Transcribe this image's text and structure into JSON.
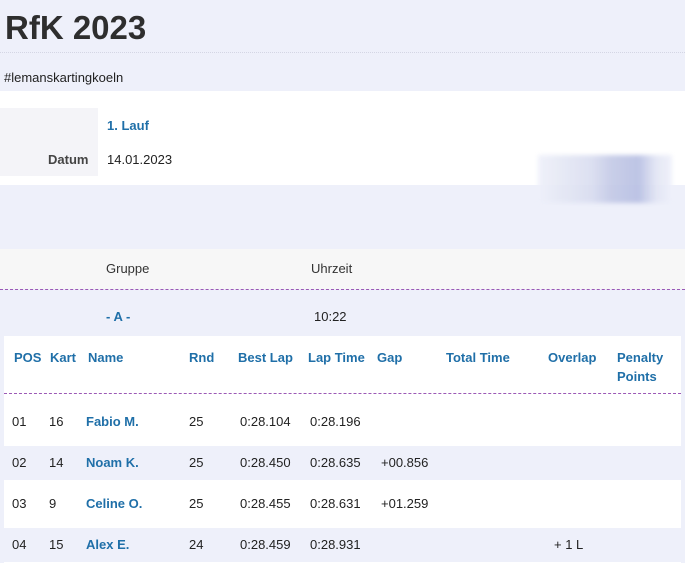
{
  "page": {
    "title": "RfK 2023",
    "hashtag": "#lemanskartingkoeln"
  },
  "event": {
    "race_title": "1. Lauf",
    "date_label": "Datum",
    "date_value": "14.01.2023"
  },
  "groups": {
    "header_group": "Gruppe",
    "header_time": "Uhrzeit",
    "group_name": "- A -",
    "group_time": "10:22"
  },
  "results": {
    "columns": {
      "pos": "POS",
      "kart": "Kart",
      "name": "Name",
      "rnd": "Rnd",
      "best_lap": "Best Lap",
      "lap_time": "Lap Time",
      "gap": "Gap",
      "total_time": "Total Time",
      "overlap": "Overlap",
      "penalty_line1": "Penalty",
      "penalty_line2": "Points"
    },
    "rows": [
      {
        "pos": "01",
        "kart": "16",
        "name": "Fabio M.",
        "rnd": "25",
        "best_lap": "0:28.104",
        "lap_time": "0:28.196",
        "gap": "",
        "total_time": "",
        "overlap": "",
        "penalty": ""
      },
      {
        "pos": "02",
        "kart": "14",
        "name": "Noam K.",
        "rnd": "25",
        "best_lap": "0:28.450",
        "lap_time": "0:28.635",
        "gap": "+00.856",
        "total_time": "",
        "overlap": "",
        "penalty": ""
      },
      {
        "pos": "03",
        "kart": "9",
        "name": "Celine O.",
        "rnd": "25",
        "best_lap": "0:28.455",
        "lap_time": "0:28.631",
        "gap": "+01.259",
        "total_time": "",
        "overlap": "",
        "penalty": ""
      },
      {
        "pos": "04",
        "kart": "15",
        "name": "Alex E.",
        "rnd": "24",
        "best_lap": "0:28.459",
        "lap_time": "0:28.931",
        "gap": "",
        "total_time": "",
        "overlap": "+ 1 L",
        "penalty": ""
      }
    ]
  },
  "colors": {
    "accent": "#1f6fa8",
    "divider": "#9b59b6",
    "band": "#eef0fa"
  }
}
